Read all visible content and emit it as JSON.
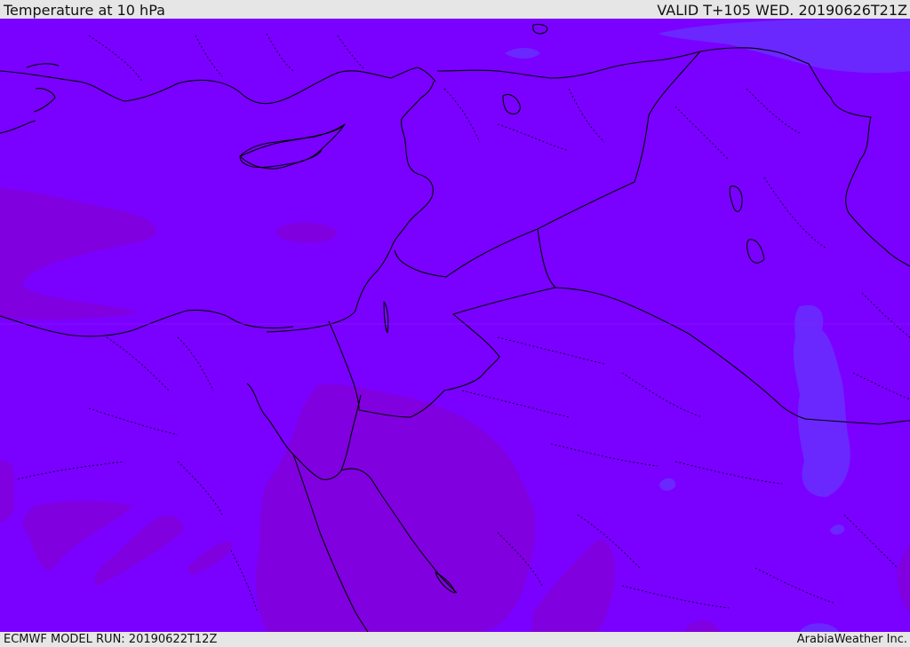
{
  "header": {
    "title": "Temperature at 10 hPa",
    "valid": "VALID T+105 WED. 20190626T21Z"
  },
  "footer": {
    "model_run": "ECMWF MODEL RUN: 20190622T12Z",
    "credit": "ArabiaWeather Inc."
  },
  "map": {
    "field": "temperature-10hpa",
    "colors": {
      "base": "#7a00ff",
      "warm": "#8000e0",
      "cool": "#6a28ff",
      "border": "#000000"
    }
  }
}
